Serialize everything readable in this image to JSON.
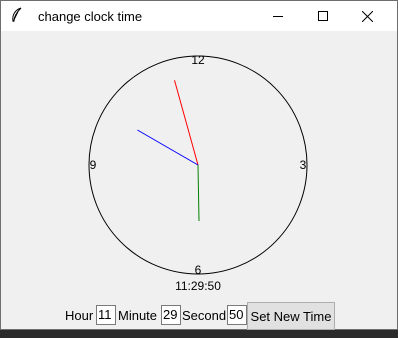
{
  "window": {
    "title": "change clock time",
    "icon": "feather-icon",
    "controls": [
      "minimize-icon",
      "maximize-icon",
      "close-icon"
    ]
  },
  "clock": {
    "numerals": {
      "top": "12",
      "right": "3",
      "bottom": "6",
      "left": "9"
    },
    "time": {
      "hour": 11,
      "minute": 29,
      "second": 50
    },
    "digital_display": "11:29:50",
    "hand_colors": {
      "hour": "#ff0000",
      "minute": "#008000",
      "second": "#0000ff"
    }
  },
  "form": {
    "hour_label": "Hour",
    "hour_value": "11",
    "minute_label": "Minute",
    "minute_value": "29",
    "second_label": "Second",
    "second_value": "50",
    "submit_label": "Set New Time"
  }
}
